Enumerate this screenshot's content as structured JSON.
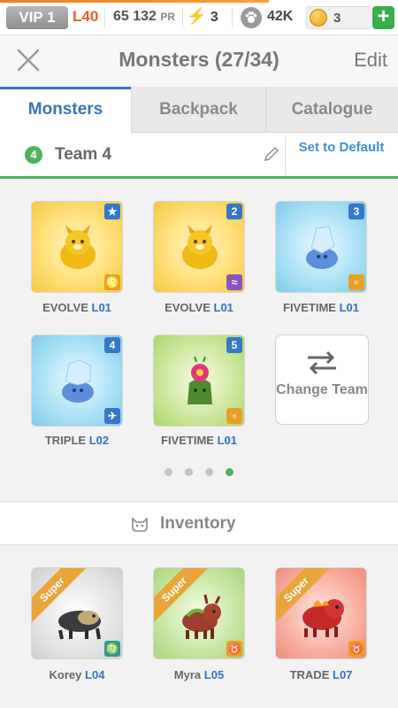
{
  "status": {
    "vip": "VIP 1",
    "level": "L40",
    "power": "65 132",
    "power_unit": "PR",
    "energy": "3",
    "paw_count": "42K",
    "coins": "3",
    "plus": "+"
  },
  "header": {
    "title": "Monsters (27/34)",
    "edit": "Edit"
  },
  "tabs": [
    "Monsters",
    "Backpack",
    "Catalogue"
  ],
  "team": {
    "number": "4",
    "name": "Team 4",
    "set_default": "Set to Default"
  },
  "team_slots": [
    {
      "slot": "★",
      "name": "EVOLVE",
      "level": "L01",
      "element": "♌"
    },
    {
      "slot": "2",
      "name": "EVOLVE",
      "level": "L01",
      "element": "≈"
    },
    {
      "slot": "3",
      "name": "FIVETIME",
      "level": "L01",
      "element": "♅"
    },
    {
      "slot": "4",
      "name": "TRIPLE",
      "level": "L02",
      "element": "✈"
    },
    {
      "slot": "5",
      "name": "FIVETIME",
      "level": "L01",
      "element": "♅"
    }
  ],
  "change_team": "Change Team",
  "pages": {
    "count": 4,
    "current": 4
  },
  "inventory": {
    "label": "Inventory",
    "items": [
      {
        "name": "Korey",
        "level": "L04",
        "badge": "Super",
        "element": "♍"
      },
      {
        "name": "Myra",
        "level": "L05",
        "badge": "Super",
        "element": "♉"
      },
      {
        "name": "TRADE",
        "level": "L07",
        "badge": "Super",
        "element": "♉"
      }
    ]
  }
}
